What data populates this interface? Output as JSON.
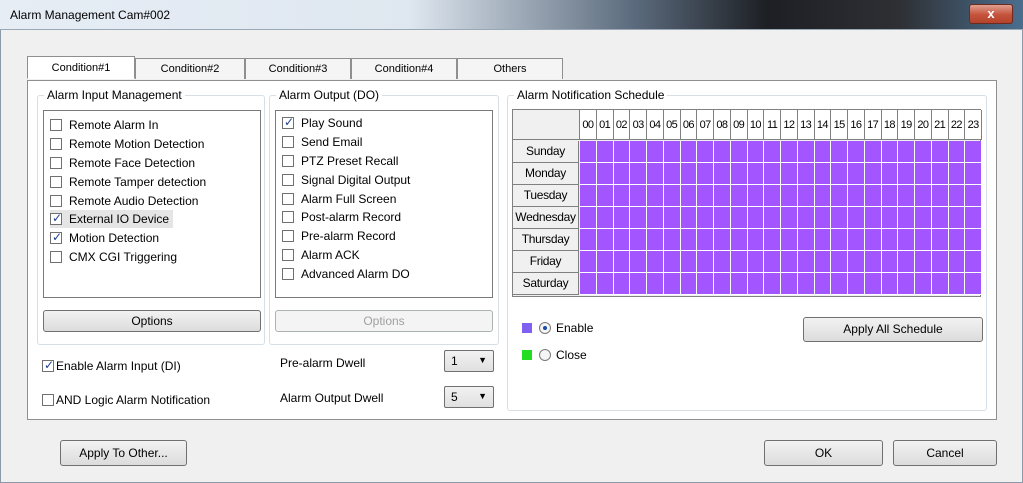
{
  "window": {
    "title": "Alarm Management Cam#002",
    "close_glyph": "x"
  },
  "tabs": [
    {
      "label": "Condition#1",
      "active": true
    },
    {
      "label": "Condition#2",
      "active": false
    },
    {
      "label": "Condition#3",
      "active": false
    },
    {
      "label": "Condition#4",
      "active": false
    },
    {
      "label": "Others",
      "active": false
    }
  ],
  "alarm_input": {
    "title": "Alarm Input Management",
    "items": [
      {
        "label": "Remote Alarm In",
        "checked": false
      },
      {
        "label": "Remote Motion Detection",
        "checked": false
      },
      {
        "label": "Remote Face Detection",
        "checked": false
      },
      {
        "label": "Remote Tamper detection",
        "checked": false
      },
      {
        "label": "Remote Audio Detection",
        "checked": false
      },
      {
        "label": "External IO Device",
        "checked": true
      },
      {
        "label": "Motion Detection",
        "checked": true
      },
      {
        "label": "CMX CGI Triggering",
        "checked": false
      }
    ],
    "options_label": "Options"
  },
  "alarm_output": {
    "title": "Alarm Output (DO)",
    "items": [
      {
        "label": "Play Sound",
        "checked": true
      },
      {
        "label": "Send Email",
        "checked": false
      },
      {
        "label": "PTZ Preset Recall",
        "checked": false
      },
      {
        "label": "Signal Digital Output",
        "checked": false
      },
      {
        "label": "Alarm Full Screen",
        "checked": false
      },
      {
        "label": "Post-alarm Record",
        "checked": false
      },
      {
        "label": "Pre-alarm Record",
        "checked": false
      },
      {
        "label": "Alarm ACK",
        "checked": false
      },
      {
        "label": "Advanced Alarm DO",
        "checked": false
      }
    ],
    "options_label": "Options"
  },
  "bottom_controls": {
    "enable_di_label": "Enable Alarm Input (DI)",
    "enable_di_checked": true,
    "and_logic_label": "AND Logic Alarm Notification",
    "and_logic_checked": false,
    "pre_alarm_label": "Pre-alarm Dwell",
    "pre_alarm_value": "1",
    "output_dwell_label": "Alarm Output Dwell",
    "output_dwell_value": "5"
  },
  "schedule": {
    "title": "Alarm Notification Schedule",
    "hours": [
      "00",
      "01",
      "02",
      "03",
      "04",
      "05",
      "06",
      "07",
      "08",
      "09",
      "10",
      "11",
      "12",
      "13",
      "14",
      "15",
      "16",
      "17",
      "18",
      "19",
      "20",
      "21",
      "22",
      "23"
    ],
    "days": [
      "Sunday",
      "Monday",
      "Tuesday",
      "Wednesday",
      "Thursday",
      "Friday",
      "Saturday"
    ],
    "cell_state": "enable",
    "enable_color": "#a355ff",
    "legend": {
      "enable_label": "Enable",
      "enable_color": "#8060f0",
      "enable_selected": true,
      "close_label": "Close",
      "close_color": "#22dd22",
      "close_selected": false
    },
    "apply_all_label": "Apply All Schedule"
  },
  "footer": {
    "apply_to_other_label": "Apply To Other...",
    "ok_label": "OK",
    "cancel_label": "Cancel"
  }
}
